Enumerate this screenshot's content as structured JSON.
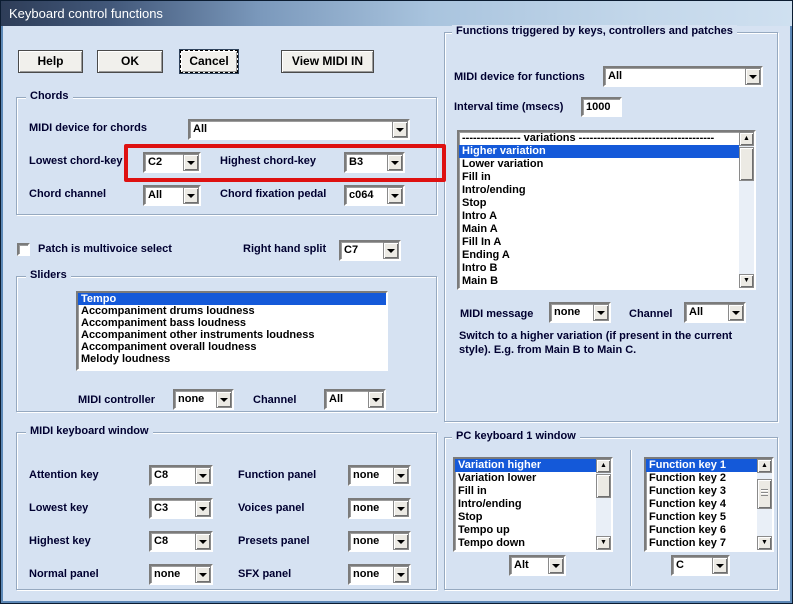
{
  "window": {
    "title": "Keyboard control functions"
  },
  "toolbar": {
    "help": "Help",
    "ok": "OK",
    "cancel": "Cancel",
    "view_midi_in": "View MIDI IN"
  },
  "chords": {
    "title": "Chords",
    "midi_device_label": "MIDI device for chords",
    "midi_device_value": "All",
    "lowest_label": "Lowest chord-key",
    "lowest_value": "C2",
    "highest_label": "Highest chord-key",
    "highest_value": "B3",
    "channel_label": "Chord channel",
    "channel_value": "All",
    "fixation_label": "Chord fixation pedal",
    "fixation_value": "c064"
  },
  "multivoice": {
    "label": "Patch is multivoice select",
    "checked": false
  },
  "right_hand_split": {
    "label": "Right hand split",
    "value": "C7"
  },
  "sliders": {
    "title": "Sliders",
    "items": [
      "Tempo",
      "Accompaniment drums loudness",
      "Accompaniment bass loudness",
      "Accompaniment other instruments loudness",
      "Accompaniment overall loudness",
      "Melody loudness"
    ],
    "selected": "Tempo",
    "controller_label": "MIDI controller",
    "controller_value": "none",
    "channel_label": "Channel",
    "channel_value": "All"
  },
  "functions": {
    "title": "Functions triggered by keys, controllers and patches",
    "device_label": "MIDI device for functions",
    "device_value": "All",
    "interval_label": "Interval time (msecs)",
    "interval_value": "1000",
    "list_header": "---------------- variations -------------------------------------",
    "items": [
      "Higher variation",
      "Lower variation",
      "Fill in",
      "Intro/ending",
      "Stop",
      "Intro A",
      "Main A",
      "Fill In A",
      "Ending A",
      "Intro B",
      "Main B"
    ],
    "selected": "Higher variation",
    "message_label": "MIDI message",
    "message_value": "none",
    "channel_label": "Channel",
    "channel_value": "All",
    "description": "Switch to a higher variation (if present in the current style). E.g. from Main B to Main C."
  },
  "midi_keyboard": {
    "title": "MIDI keyboard window",
    "attention_label": "Attention key",
    "attention_value": "C8",
    "lowest_label": "Lowest key",
    "lowest_value": "C3",
    "highest_label": "Highest key",
    "highest_value": "C8",
    "normal_label": "Normal panel",
    "normal_value": "none",
    "function_label": "Function panel",
    "function_value": "none",
    "voices_label": "Voices panel",
    "voices_value": "none",
    "presets_label": "Presets panel",
    "presets_value": "none",
    "sfx_label": "SFX panel",
    "sfx_value": "none"
  },
  "pc_keyboard": {
    "title": "PC keyboard 1 window",
    "actions": [
      "Variation higher",
      "Variation lower",
      "Fill in",
      "Intro/ending",
      "Stop",
      "Tempo up",
      "Tempo down"
    ],
    "actions_selected": "Variation higher",
    "modifier_value": "Alt",
    "keys": [
      "Function key 1",
      "Function key 2",
      "Function key 3",
      "Function key 4",
      "Function key 5",
      "Function key 6",
      "Function key 7"
    ],
    "keys_selected": "Function key 1",
    "key_value": "C"
  },
  "colors": {
    "highlight": "#1459d9",
    "annotation": "#de1111",
    "dialog_background": "#d6e2f2",
    "titlebar_left": "#2e3d58",
    "titlebar_right": "#cfe0f0"
  }
}
